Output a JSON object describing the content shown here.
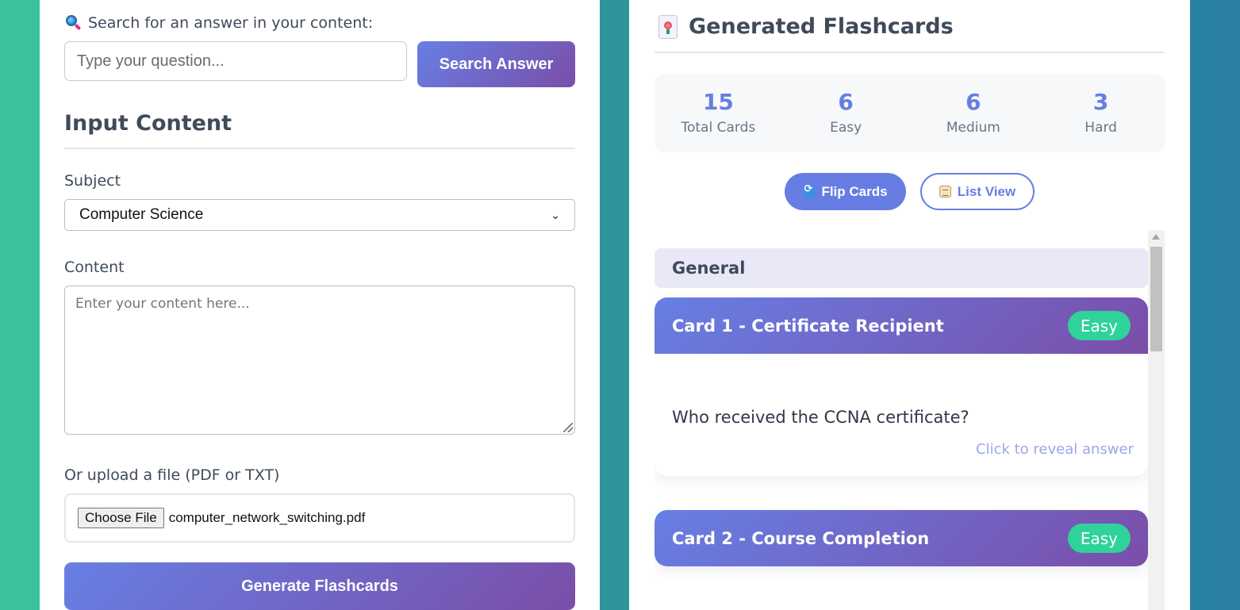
{
  "left": {
    "search_label": "Search for an answer in your content:",
    "search_placeholder": "Type your question...",
    "search_button": "Search Answer",
    "section_title": "Input Content",
    "subject_label": "Subject",
    "subject_value": "Computer Science",
    "content_label": "Content",
    "content_placeholder": "Enter your content here...",
    "upload_label": "Or upload a file (PDF or TXT)",
    "choose_file_button": "Choose File",
    "file_name": "computer_network_switching.pdf",
    "generate_button": "Generate Flashcards"
  },
  "right": {
    "title": "Generated Flashcards",
    "stats": [
      {
        "value": "15",
        "label": "Total Cards"
      },
      {
        "value": "6",
        "label": "Easy"
      },
      {
        "value": "6",
        "label": "Medium"
      },
      {
        "value": "3",
        "label": "Hard"
      }
    ],
    "flip_button": "Flip Cards",
    "list_button": "List View",
    "group": "General",
    "cards": [
      {
        "title": "Card 1 - Certificate Recipient",
        "difficulty": "Easy",
        "question": "Who received the CCNA certificate?",
        "hint": "Click to reveal answer"
      },
      {
        "title": "Card 2 - Course Completion",
        "difficulty": "Easy"
      }
    ]
  },
  "colors": {
    "accent": "#667ee3",
    "gradient_start": "#677fe4",
    "gradient_end": "#7a4ea8",
    "easy_badge": "#2fd29b"
  },
  "icons": [
    "magnifier-icon",
    "flashcards-icon",
    "flip-icon",
    "list-icon"
  ]
}
